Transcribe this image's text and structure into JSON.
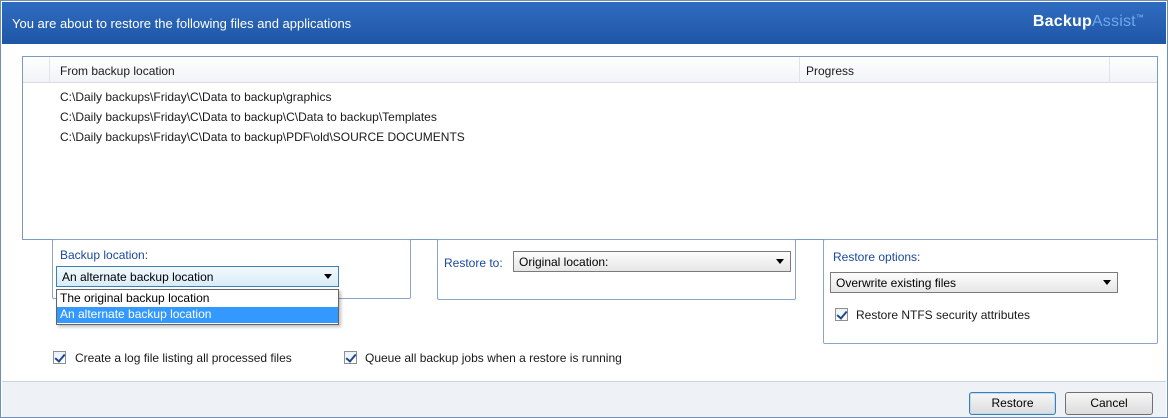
{
  "header": {
    "title": "You are about to restore the following files and applications",
    "brand_part1": "Backup",
    "brand_part2": "Assist",
    "brand_tm": "™"
  },
  "file_list": {
    "columns": [
      "From backup location",
      "Progress"
    ],
    "rows": [
      {
        "path": "C:\\Daily backups\\Friday\\C\\Data to backup\\graphics",
        "progress": ""
      },
      {
        "path": "C:\\Daily backups\\Friday\\C\\Data to backup\\C\\Data to backup\\Templates",
        "progress": ""
      },
      {
        "path": "C:\\Daily backups\\Friday\\C\\Data to backup\\PDF\\old\\SOURCE DOCUMENTS",
        "progress": ""
      }
    ]
  },
  "backup_location": {
    "label": "Backup location:",
    "selected": "An alternate backup location",
    "options": [
      "The original backup location",
      "An alternate backup location"
    ]
  },
  "restore_to": {
    "label": "Restore to:",
    "selected": "Original location:"
  },
  "restore_options": {
    "label": "Restore options:",
    "selected": "Overwrite existing files",
    "ntfs_label": "Restore NTFS security attributes",
    "ntfs_checked": true
  },
  "bottom_options": {
    "log_label": "Create a log file listing all processed files",
    "log_checked": true,
    "queue_label": "Queue all backup jobs when a restore is running",
    "queue_checked": true
  },
  "buttons": {
    "restore": "Restore",
    "cancel": "Cancel"
  },
  "colors": {
    "header_bg": "#2461b4",
    "label_blue": "#1b49a0",
    "selection": "#3399ff"
  }
}
